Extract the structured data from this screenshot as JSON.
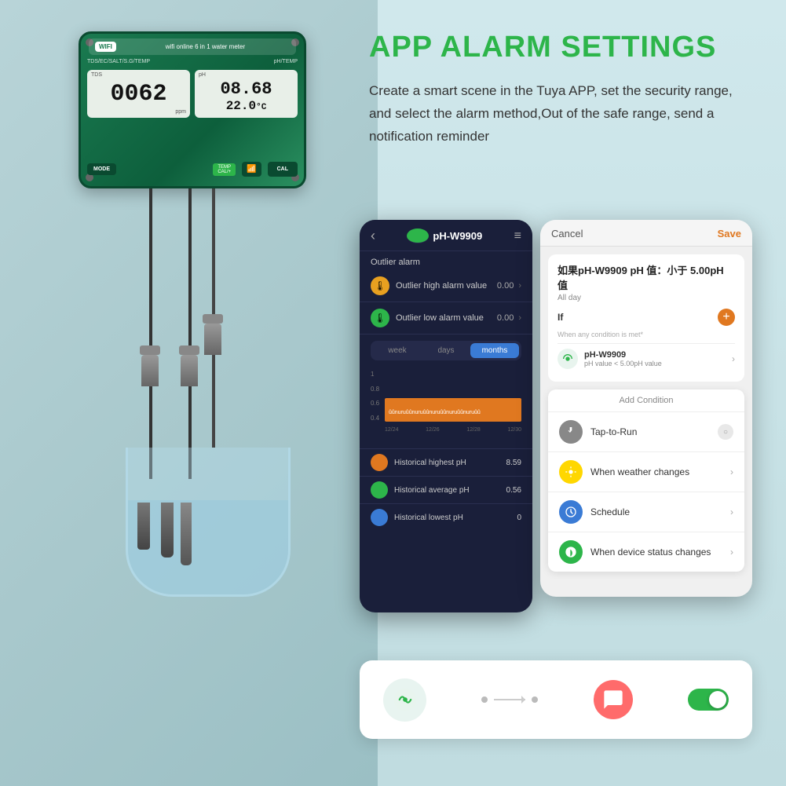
{
  "page": {
    "background": "#b8d4d8"
  },
  "title": {
    "main": "APP ALARM SETTINGS",
    "description": "Create a smart scene in the Tuya APP, set the security range, and select the alarm method,Out of the safe range, send a notification reminder"
  },
  "device": {
    "wifi_label": "WIFI",
    "device_name": "wifi online 6 in 1 water meter",
    "left_label": "TDS/EC/SALT/S.G/TEMP",
    "right_label": "pH/TEMP",
    "tds_value": "0062",
    "tds_unit": "ppm",
    "tds_sublabel": "TDS",
    "ph_value": "08.68",
    "temp_value": "22.0",
    "temp_unit": "°C",
    "ph_sublabel": "pH",
    "btn_mode": "MODE",
    "btn_cal": "CAL"
  },
  "phone_left": {
    "back": "‹",
    "device_name": "pH-W9909",
    "menu": "≡",
    "section_label": "Outlier alarm",
    "alarm_high_label": "Outlier high alarm value",
    "alarm_high_value": "0.00",
    "alarm_low_label": "Outlier low alarm value",
    "alarm_low_value": "0.00",
    "tabs": [
      "week",
      "days",
      "months"
    ],
    "active_tab": "months",
    "chart_y": [
      "1",
      "0.8",
      "0.6",
      "0.4"
    ],
    "chart_x": [
      "12/24",
      "12/26",
      "12/28",
      "12/30"
    ],
    "chart_bar_text": "ûûnuruûûnuruûûnuruûûnuruûûnuruûûnuruûûnuruûûnuru",
    "hist_rows": [
      {
        "label": "Historical highest pH",
        "value": "8.59"
      },
      {
        "label": "Historical average pH",
        "value": "0.56"
      },
      {
        "label": "Historical lowest pH",
        "value": "0"
      }
    ]
  },
  "phone_right": {
    "cancel_label": "Cancel",
    "save_label": "Save",
    "condition_title": "如果pH-W9909 pH 值：小于 5.00pH 值",
    "all_day_label": "All day",
    "if_label": "If",
    "when_any_condition": "When any condition is met*",
    "device_name": "pH-W9909",
    "device_condition": "pH value < 5.00pH value",
    "add_condition_title": "Add Condition",
    "conditions": [
      {
        "label": "Tap-to-Run",
        "icon": "tap-icon"
      },
      {
        "label": "When weather changes",
        "icon": "weather-icon"
      },
      {
        "label": "Schedule",
        "icon": "schedule-icon"
      },
      {
        "label": "When device status changes",
        "icon": "device-status-icon"
      }
    ]
  },
  "flow_card": {
    "toggle_on": true
  }
}
